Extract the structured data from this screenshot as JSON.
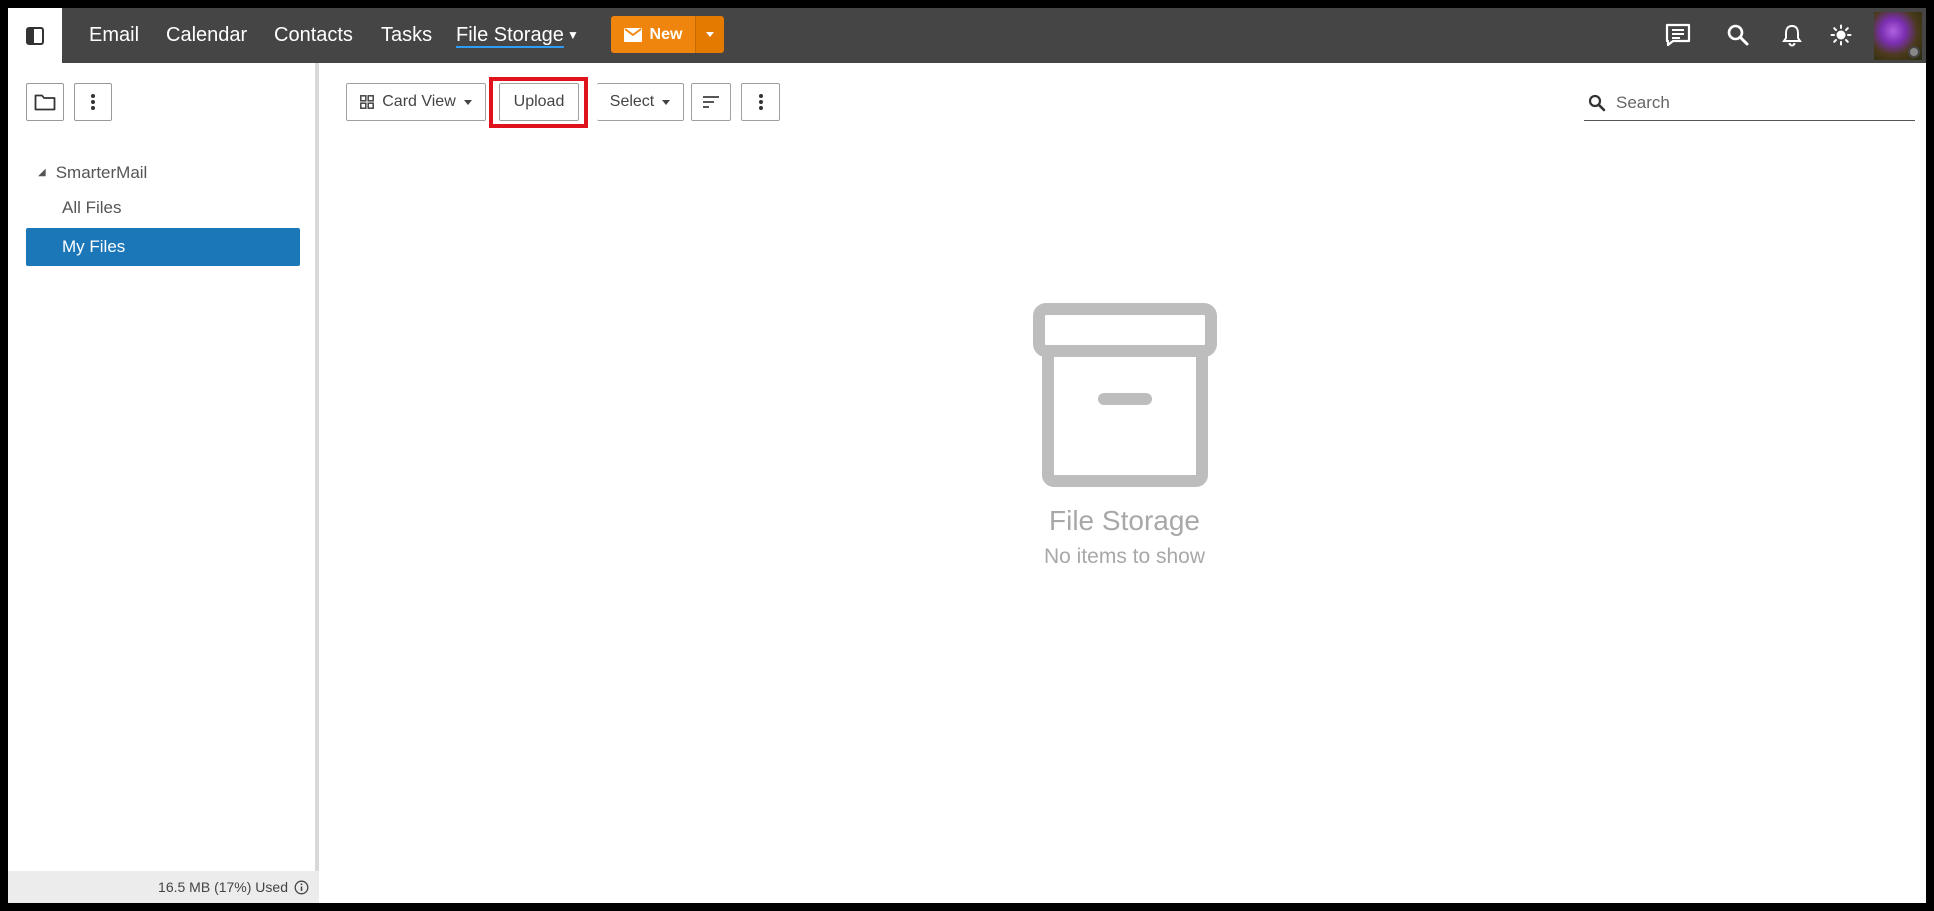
{
  "nav": {
    "items": [
      "Email",
      "Calendar",
      "Contacts",
      "Tasks",
      "File Storage"
    ],
    "new_label": "New"
  },
  "toolbar": {
    "view_label": "Card View",
    "upload_label": "Upload",
    "select_label": "Select",
    "search_placeholder": "Search"
  },
  "sidebar": {
    "root_label": "SmarterMail",
    "items": [
      {
        "label": "All Files",
        "active": false
      },
      {
        "label": "My Files",
        "active": true
      }
    ],
    "storage_used": "16.5 MB (17%) Used"
  },
  "empty_state": {
    "title": "File Storage",
    "subtitle": "No items to show"
  },
  "colors": {
    "topbar": "#454545",
    "accent_orange": "#f0850d",
    "active_blue": "#1c77b9",
    "highlight_red": "#e0121b",
    "underline_blue": "#2f9cf5"
  },
  "icons": {
    "sidebar_toggle": "sidebar-toggle-icon",
    "new": "mail-icon",
    "chat": "chat-icon",
    "search": "search-icon",
    "notifications": "bell-icon",
    "theme": "sun-icon",
    "folder": "folder-icon",
    "more": "kebab-icon",
    "card_view": "grid-icon",
    "sort": "sort-icon",
    "empty": "archive-box-icon",
    "info": "info-icon"
  }
}
